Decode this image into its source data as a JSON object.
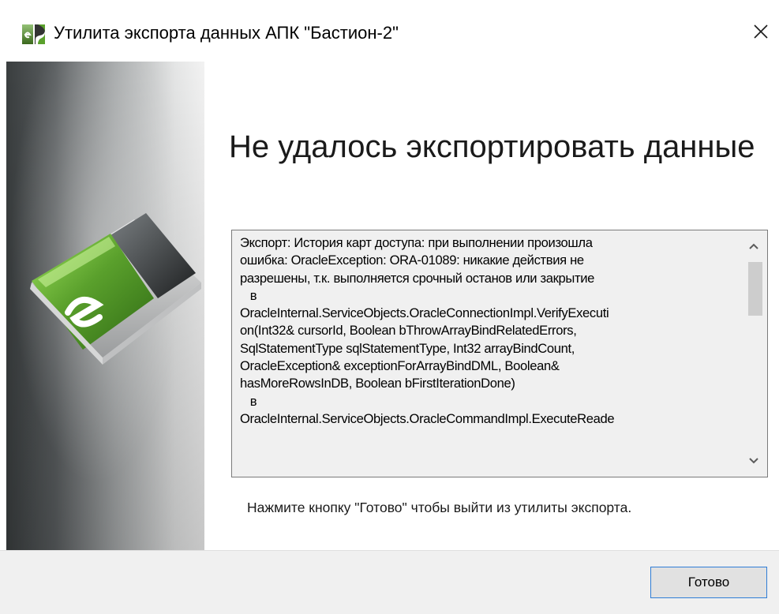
{
  "window": {
    "title": "Утилита экспорта данных АПК \"Бастион-2\"",
    "app_icon": "bastion-app-icon",
    "close_icon": "close-icon"
  },
  "banner": {
    "logo_icon": "bastion-e-logo-icon"
  },
  "main": {
    "heading": "Не удалось экспортировать данные",
    "log": {
      "text": "Экспорт: История карт доступа: при выполнении произошла\nошибка: OracleException: ORA-01089: никакие действия не\nразрешены, т.к. выполняется срочный останов или закрытие\n   в\nOracleInternal.ServiceObjects.OracleConnectionImpl.VerifyExecuti\non(Int32& cursorId, Boolean bThrowArrayBindRelatedErrors,\nSqlStatementType sqlStatementType, Int32 arrayBindCount,\nOracleException& exceptionForArrayBindDML, Boolean&\nhasMoreRowsInDB, Boolean bFirstIterationDone)\n   в\nOracleInternal.ServiceObjects.OracleCommandImpl.ExecuteReade",
      "scroll_up_icon": "chevron-up-icon",
      "scroll_down_icon": "chevron-down-icon"
    },
    "hint": "Нажмите кнопку \"Готово\" чтобы выйти из утилиты экспорта."
  },
  "footer": {
    "done_label": "Готово"
  },
  "colors": {
    "brand_green": "#5aa02c",
    "focus_blue": "#2f7dd6",
    "footer_bg": "#f0f0f0",
    "log_bg": "#f0f0f0"
  }
}
